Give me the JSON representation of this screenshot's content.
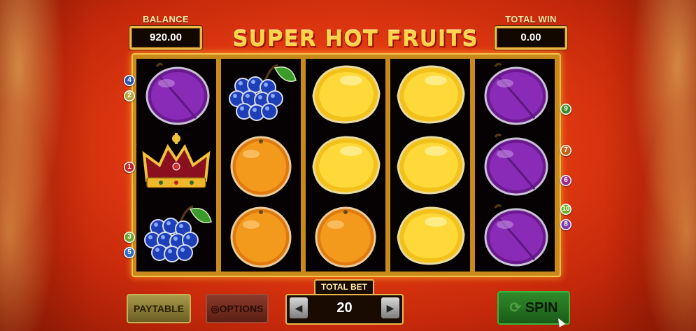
{
  "header": {
    "balance_label": "BALANCE",
    "balance_value": "920.00",
    "total_win_label": "TOTAL WIN",
    "total_win_value": "0.00",
    "logo_text": "SUPER HOT FRUITS"
  },
  "reels": [
    [
      "plum",
      "crown",
      "grapes"
    ],
    [
      "grapes",
      "orange",
      "orange"
    ],
    [
      "lemon",
      "lemon",
      "orange"
    ],
    [
      "lemon",
      "lemon",
      "lemon"
    ],
    [
      "plum",
      "plum",
      "plum"
    ]
  ],
  "paylines_left": [
    "4",
    "2",
    "1",
    "3",
    "5"
  ],
  "paylines_right": [
    "9",
    "7",
    "6",
    "10",
    "8"
  ],
  "payline_colors": {
    "1": "#c0282a",
    "2": "#b8a43a",
    "3": "#6aa42a",
    "4": "#2f55b0",
    "5": "#2f68c0",
    "6": "#a02a8a",
    "7": "#c2631c",
    "8": "#7a3ab0",
    "9": "#3e8a2a",
    "10": "#6fae2a"
  },
  "controls": {
    "paytable_label": "PAYTABLE",
    "options_label": "OPTIONS",
    "total_bet_label": "TOTAL BET",
    "total_bet_value": "20",
    "spin_label": "SPIN"
  }
}
